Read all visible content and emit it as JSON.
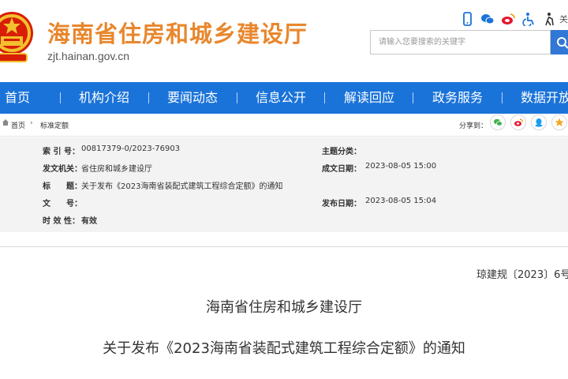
{
  "header": {
    "site_title": "海南省住房和城乡建设厅",
    "site_url": "zjt.hainan.gov.cn",
    "top_more_label": "关",
    "icons": [
      "mobile-icon",
      "wechat-icon",
      "weibo-icon",
      "accessibility-icon",
      "elderly-mode-icon"
    ],
    "search": {
      "placeholder": "请输入您要搜索的关键字"
    },
    "colors": {
      "title": "#e8872d",
      "emblem_red": "#d81e06",
      "emblem_gold": "#f2c12e"
    }
  },
  "nav": {
    "color": "#1a73d9",
    "items": [
      {
        "label": "首页"
      },
      {
        "label": "机构介绍"
      },
      {
        "label": "要闻动态"
      },
      {
        "label": "信息公开"
      },
      {
        "label": "解读回应"
      },
      {
        "label": "政务服务"
      },
      {
        "label": "数据开放"
      }
    ]
  },
  "breadcrumb": {
    "home": "首页",
    "current": "标准定额",
    "share_label": "分享到：",
    "share_icons": [
      "wechat-icon",
      "weibo-icon",
      "qq-icon",
      "qzone-icon"
    ]
  },
  "meta": {
    "index_label": "索 引 号：",
    "index_value": "00817379-0/2023-76903",
    "topic_label": "主题分类：",
    "topic_value": "",
    "issuer_label": "发文机关：",
    "issuer_value": "省住房和城乡建设厅",
    "written_date_label": "成文日期：",
    "written_date_value": "2023-08-05 15:00",
    "title_label": "标　　题：",
    "title_value": "关于发布《2023海南省装配式建筑工程综合定额》的通知",
    "docnum_label": "文　　号：",
    "docnum_value": "",
    "publish_date_label": "发布日期：",
    "publish_date_value": "2023-08-05 15:04",
    "validity_label": "时 效 性：",
    "validity_value": "有效"
  },
  "document": {
    "doc_number": "琼建规〔2023〕6号",
    "issuer_heading": "海南省住房和城乡建设厅",
    "title_heading": "关于发布《2023海南省装配式建筑工程综合定额》的通知"
  }
}
